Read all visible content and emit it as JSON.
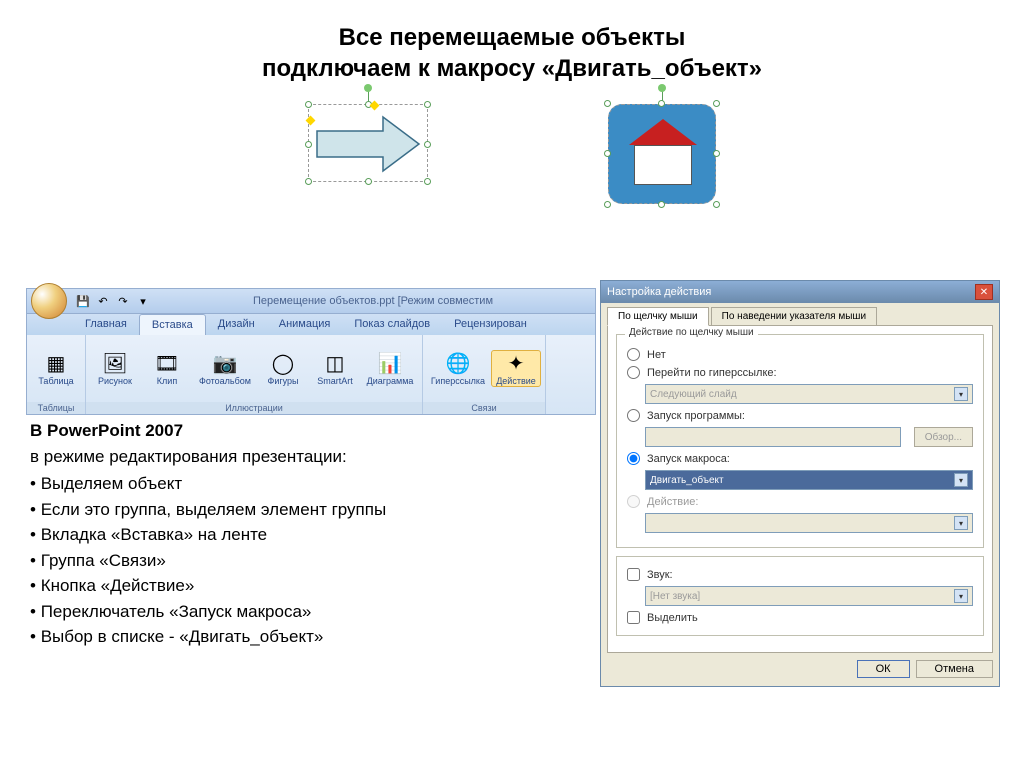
{
  "title_line1": "Все перемещаемые объекты",
  "title_line2": "подключаем к макросу «Двигать_объект»",
  "ribbon": {
    "doc_title": "Перемещение объектов.ppt [Режим совместим",
    "tabs": [
      "Главная",
      "Вставка",
      "Дизайн",
      "Анимация",
      "Показ слайдов",
      "Рецензирован"
    ],
    "groups": {
      "tables": {
        "label": "Таблицы",
        "items": [
          {
            "label": "Таблица",
            "glyph": "▦"
          }
        ]
      },
      "illustrations": {
        "label": "Иллюстрации",
        "items": [
          {
            "label": "Рисунок",
            "glyph": "🖼"
          },
          {
            "label": "Клип",
            "glyph": "🎞"
          },
          {
            "label": "Фотоальбом",
            "glyph": "📷"
          },
          {
            "label": "Фигуры",
            "glyph": "◯"
          },
          {
            "label": "SmartArt",
            "glyph": "◫"
          },
          {
            "label": "Диаграмма",
            "glyph": "📊"
          }
        ]
      },
      "links": {
        "label": "Связи",
        "items": [
          {
            "label": "Гиперссылка",
            "glyph": "🌐"
          },
          {
            "label": "Действие",
            "glyph": "✦"
          }
        ]
      }
    }
  },
  "dialog": {
    "title": "Настройка действия",
    "tab1": "По щелчку мыши",
    "tab2": "По наведении указателя мыши",
    "group_label": "Действие по щелчку мыши",
    "opt_none": "Нет",
    "opt_hyperlink": "Перейти по гиперссылке:",
    "hyperlink_value": "Следующий слайд",
    "opt_program": "Запуск программы:",
    "browse": "Обзор...",
    "opt_macro": "Запуск макроса:",
    "macro_value": "Двигать_объект",
    "opt_action": "Действие:",
    "chk_sound": "Звук:",
    "sound_value": "[Нет звука]",
    "chk_highlight": "Выделить",
    "btn_ok": "ОК",
    "btn_cancel": "Отмена"
  },
  "instructions": {
    "heading": "В PowerPoint 2007",
    "subtitle": "в режиме редактирования презентации:",
    "items": [
      "Выделяем объект",
      "Если это группа, выделяем элемент группы",
      "Вкладка «Вставка» на ленте",
      "Группа «Связи»",
      "Кнопка «Действие»",
      "Переключатель «Запуск макроса»",
      "Выбор в списке - «Двигать_объект»"
    ]
  }
}
